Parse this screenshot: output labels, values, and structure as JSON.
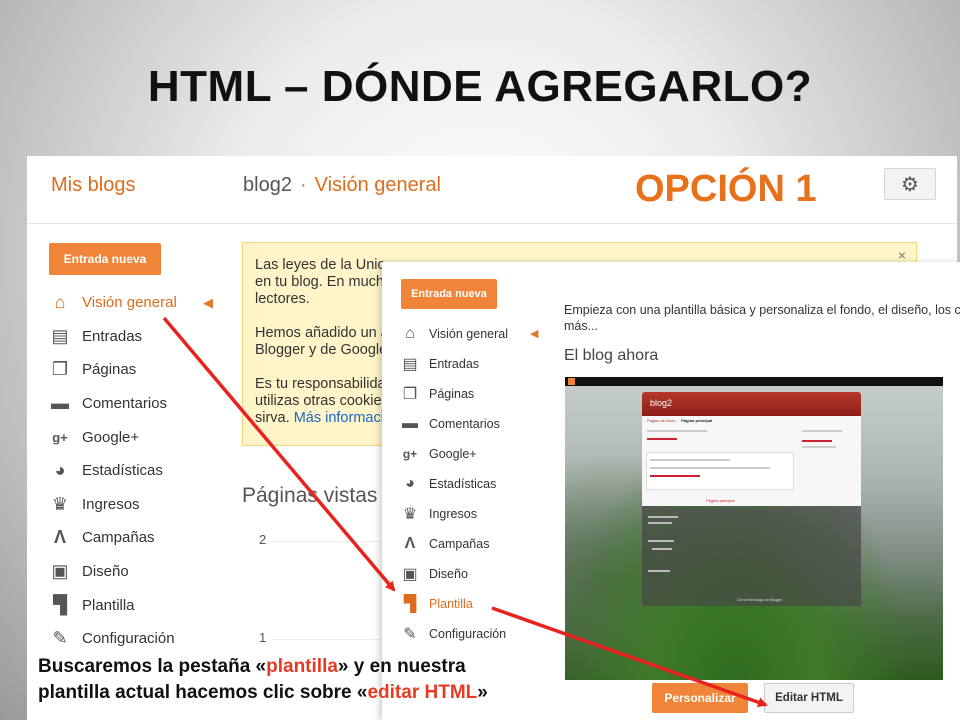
{
  "slide": {
    "title": "HTML – DÓNDE AGREGARLO?",
    "option_label": "OPCIÓN 1"
  },
  "back_panel": {
    "my_blogs": "Mis blogs",
    "blog_name": "blog2",
    "separator": "·",
    "section": "Visión general",
    "new_post_button": "Entrada nueva",
    "settings_icon": "gear-icon",
    "nav": [
      {
        "label": "Visión general",
        "icon": "home-icon"
      },
      {
        "label": "Entradas",
        "icon": "posts-icon"
      },
      {
        "label": "Páginas",
        "icon": "pages-icon"
      },
      {
        "label": "Comentarios",
        "icon": "comments-icon"
      },
      {
        "label": "Google+",
        "icon": "google-plus-icon"
      },
      {
        "label": "Estadísticas",
        "icon": "stats-icon"
      },
      {
        "label": "Ingresos",
        "icon": "trophy-icon"
      },
      {
        "label": "Campañas",
        "icon": "campaigns-icon"
      },
      {
        "label": "Diseño",
        "icon": "layout-icon"
      },
      {
        "label": "Plantilla",
        "icon": "template-icon"
      },
      {
        "label": "Configuración",
        "icon": "wrench-icon"
      }
    ],
    "notice": {
      "line1": "Las leyes de la Unic",
      "line2": "en tu blog. En much",
      "line3": "lectores.",
      "line4": "Hemos añadido un a",
      "line5": "Blogger y de Google",
      "line6": "Es tu responsabilida",
      "line7": "utilizas otras cookie",
      "line8_prefix": "sirva.",
      "line8_link": "Más informaci",
      "close": "×"
    },
    "pageviews_title": "Páginas vistas",
    "pageviews_ticks": [
      "2",
      "1"
    ]
  },
  "front_panel": {
    "new_post_button": "Entrada nueva",
    "nav": [
      {
        "label": "Visión general",
        "icon": "home-icon"
      },
      {
        "label": "Entradas",
        "icon": "posts-icon"
      },
      {
        "label": "Páginas",
        "icon": "pages-icon"
      },
      {
        "label": "Comentarios",
        "icon": "comments-icon"
      },
      {
        "label": "Google+",
        "icon": "google-plus-icon"
      },
      {
        "label": "Estadísticas",
        "icon": "stats-icon"
      },
      {
        "label": "Ingresos",
        "icon": "trophy-icon"
      },
      {
        "label": "Campañas",
        "icon": "campaigns-icon"
      },
      {
        "label": "Diseño",
        "icon": "layout-icon"
      },
      {
        "label": "Plantilla",
        "icon": "template-icon"
      },
      {
        "label": "Configuración",
        "icon": "wrench-icon"
      }
    ],
    "active_item": "Plantilla",
    "intro_line1": "Empieza con una plantilla básica y personaliza el fondo, el diseño, los c",
    "intro_line2": "más...",
    "preview_heading": "El blog ahora",
    "preview": {
      "blog_title": "blog2",
      "tab_home": "Página de inicio",
      "tab_main": "Página principal",
      "bottom_link": "Página principal",
      "footer": "Con la tecnología de Blogger."
    },
    "customize_button": "Personalizar",
    "edit_html_button": "Editar HTML"
  },
  "caption": {
    "part1": "Buscaremos la pestaña «",
    "hl1": "plantilla",
    "part2": "» y en nuestra",
    "part3": "plantilla actual hacemos clic sobre «",
    "hl2": "editar HTML",
    "part4": "»"
  },
  "colors": {
    "accent": "#f08438",
    "arrow": "#e8231e",
    "option_label": "#e8711c",
    "caption_highlight": "#e63a25"
  }
}
